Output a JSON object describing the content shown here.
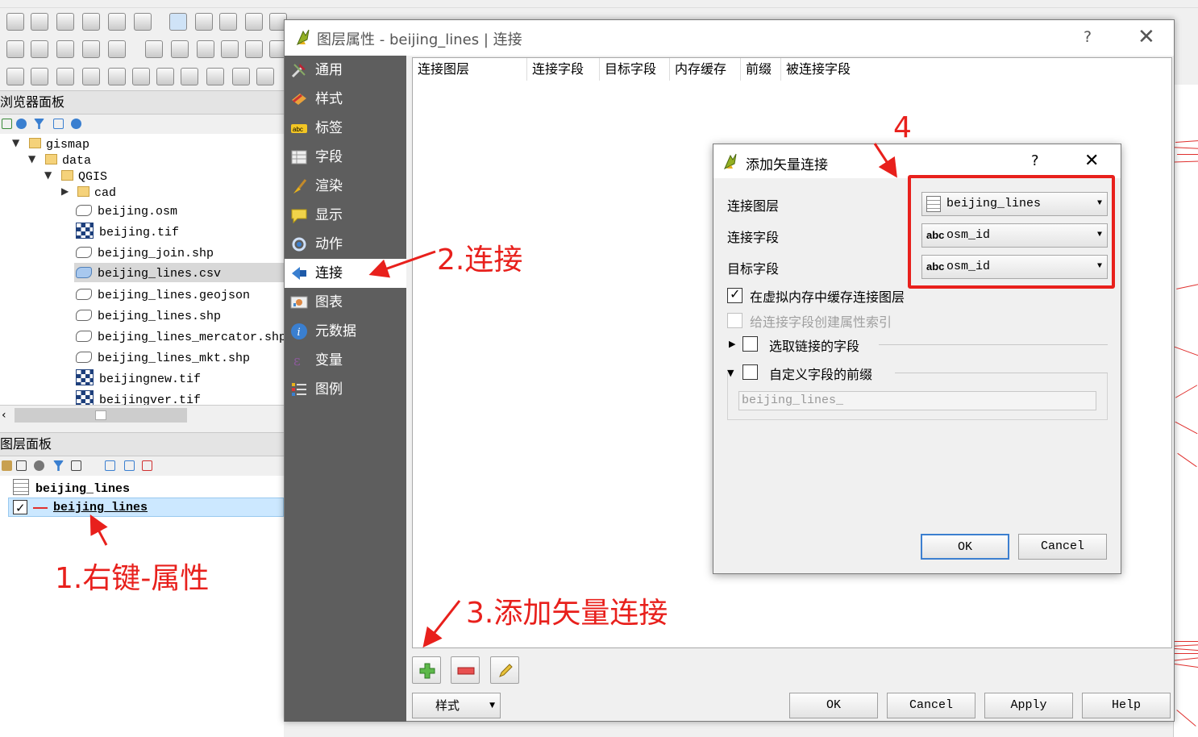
{
  "browser_panel": {
    "title": "浏览器面板",
    "tree": [
      {
        "label": "gismap",
        "kind": "folder"
      },
      {
        "label": "data",
        "kind": "folder"
      },
      {
        "label": "QGIS",
        "kind": "folder"
      },
      {
        "label": "cad",
        "kind": "folder"
      },
      {
        "label": "beijing.osm",
        "kind": "vector"
      },
      {
        "label": "beijing.tif",
        "kind": "raster"
      },
      {
        "label": "beijing_join.shp",
        "kind": "vector"
      },
      {
        "label": "beijing_lines.csv",
        "kind": "vector-selected"
      },
      {
        "label": "beijing_lines.geojson",
        "kind": "vector"
      },
      {
        "label": "beijing_lines.shp",
        "kind": "vector"
      },
      {
        "label": "beijing_lines_mercator.shp",
        "kind": "vector"
      },
      {
        "label": "beijing_lines_mkt.shp",
        "kind": "vector"
      },
      {
        "label": "beijingnew.tif",
        "kind": "raster"
      },
      {
        "label": "beijingver.tif",
        "kind": "raster"
      }
    ]
  },
  "layers_panel": {
    "title": "图层面板",
    "layers": [
      {
        "label": "beijing_lines",
        "checked": false
      },
      {
        "label": "beijing_lines",
        "checked": true
      }
    ]
  },
  "properties_dialog": {
    "title": "图层属性 - beijing_lines | 连接",
    "help": "?",
    "close": "✕",
    "tabs": [
      "通用",
      "样式",
      "标签",
      "字段",
      "渲染",
      "显示",
      "动作",
      "连接",
      "图表",
      "元数据",
      "变量",
      "图例"
    ],
    "active_tab": "连接",
    "table_columns": [
      "连接图层",
      "连接字段",
      "目标字段",
      "内存缓存",
      "前缀",
      "被连接字段"
    ],
    "style_button": "样式",
    "buttons": {
      "ok": "OK",
      "cancel": "Cancel",
      "apply": "Apply",
      "help": "Help"
    }
  },
  "join_dialog": {
    "title": "添加矢量连接",
    "help": "?",
    "close": "✕",
    "join_layer_label": "连接图层",
    "join_layer_value": "beijing_lines",
    "join_field_label": "连接字段",
    "join_field_value": "osm_id",
    "target_field_label": "目标字段",
    "target_field_value": "osm_id",
    "field_type_badge": "abc",
    "cache_label": "在虚拟内存中缓存连接图层",
    "cache_checked": true,
    "index_label": "给连接字段创建属性索引",
    "select_fields_label": "选取链接的字段",
    "custom_prefix_label": "自定义字段的前缀",
    "prefix_value": "beijing_lines_",
    "ok": "OK",
    "cancel": "Cancel"
  },
  "annotations": {
    "step1": "1.右键-属性",
    "step2": "2.连接",
    "step3": "3.添加矢量连接",
    "step4": "4",
    "color": "#e8201c"
  },
  "colors": {
    "sidebar_bg": "#5e5e5e",
    "selection": "#cce8ff",
    "map_line": "#e0302e"
  }
}
